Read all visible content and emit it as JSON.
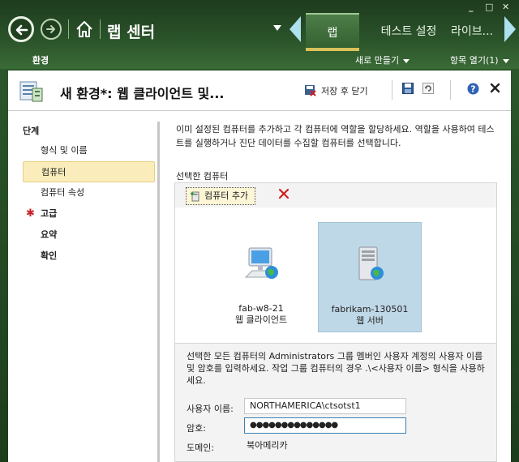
{
  "window": {
    "minimize": "_",
    "maximize": "□",
    "close": "✕"
  },
  "header": {
    "app_title": "랩 센터",
    "tabs": [
      {
        "label": "랩",
        "active": true
      },
      {
        "label": "테스트 설정",
        "active": false
      },
      {
        "label": "라이브...",
        "active": false
      }
    ],
    "subnav": {
      "environment": "환경",
      "new": "새로 만들기",
      "open_item": "항목 열기(1)"
    }
  },
  "panel": {
    "title": "새 환경*: 웹 클라이언트 및...",
    "save_close": "저장 후 닫기"
  },
  "steps": {
    "title": "단계",
    "items": [
      {
        "label": "형식 및 이름",
        "kind": "sub"
      },
      {
        "label": "컴퓨터",
        "kind": "sub",
        "selected": true
      },
      {
        "label": "컴퓨터 속성",
        "kind": "sub"
      },
      {
        "label": "고급",
        "kind": "top",
        "required": true
      },
      {
        "label": "요약",
        "kind": "top"
      },
      {
        "label": "확인",
        "kind": "top"
      }
    ]
  },
  "content": {
    "intro": "이미 설정된 컴퓨터를 추가하고 각 컴퓨터에 역할을 할당하세요. 역할을 사용하여 테스트를 실행하거나 진단 데이터를 수집할 컴퓨터를 선택합니다.",
    "selected_label": "선택한 컴퓨터",
    "add_computer": "컴퓨터 추가",
    "computers": [
      {
        "name": "fab-w8-21",
        "role": "웹 클라이언트",
        "icon": "workstation-icon",
        "selected": false
      },
      {
        "name": "fabrikam-130501",
        "role": "웹 서버",
        "icon": "server-icon",
        "selected": true
      }
    ],
    "credentials_text": "선택한 모든 컴퓨터의 Administrators 그룹 멤버인 사용자 계정의 사용자 이름 및 암호를 입력하세요. 작업 그룹 컴퓨터의 경우 .\\<사용자 이름> 형식을 사용하세요.",
    "username_label": "사용자 이름:",
    "username_value": "NORTHAMERICA\\ctsotst1",
    "password_label": "암호:",
    "password_value": "●●●●●●●●●●●●●●",
    "domain_label": "도메인:",
    "domain_value": "북아메리카"
  },
  "colors": {
    "accent_green": "#2a5229",
    "tab_highlight": "#d9c25a",
    "selection": "#fbedbb",
    "computer_selected": "#bfd8e7"
  }
}
